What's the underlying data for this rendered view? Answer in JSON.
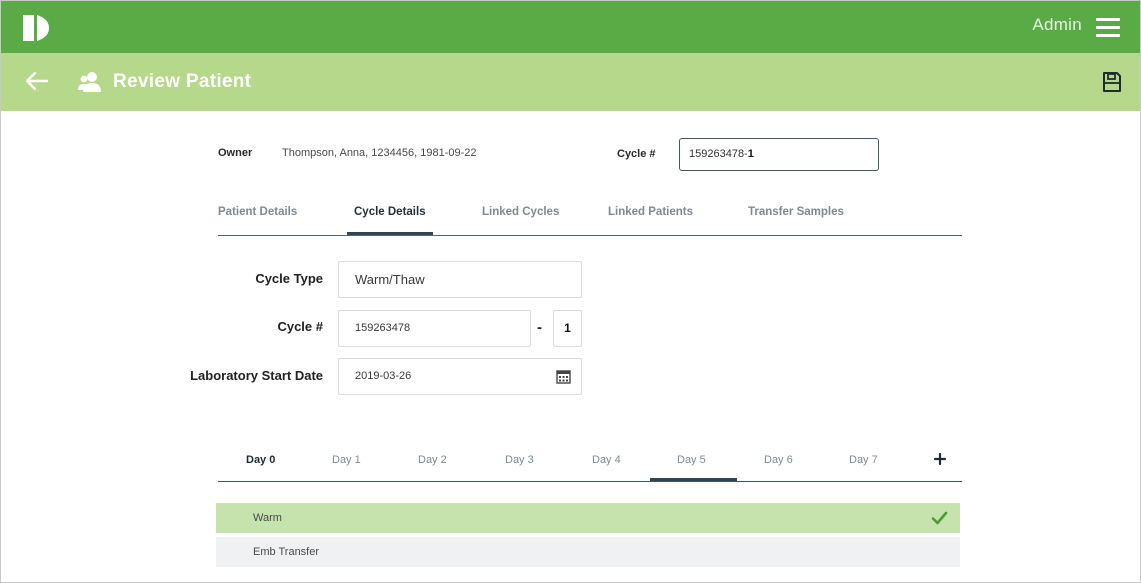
{
  "header": {
    "user_label": "Admin",
    "page_title": "Review Patient",
    "colors": {
      "brand_green": "#5aab46",
      "sub_green": "#b5d88a"
    }
  },
  "owner": {
    "label": "Owner",
    "value": "Thompson, Anna, 1234456, 1981-09-22"
  },
  "cycle_header": {
    "label": "Cycle #",
    "value_main": "159263478-",
    "value_suffix": "1"
  },
  "tabs": [
    {
      "label": "Patient Details",
      "active": false
    },
    {
      "label": "Cycle Details",
      "active": true
    },
    {
      "label": "Linked Cycles",
      "active": false
    },
    {
      "label": "Linked Patients",
      "active": false
    },
    {
      "label": "Transfer Samples",
      "active": false
    }
  ],
  "form": {
    "cycle_type": {
      "label": "Cycle Type",
      "value": "Warm/Thaw"
    },
    "cycle_number": {
      "label": "Cycle #",
      "value": "159263478",
      "suffix": "1",
      "separator": "-"
    },
    "lab_start_date": {
      "label": "Laboratory Start Date",
      "value": "2019-03-26"
    }
  },
  "day_tabs": [
    {
      "label": "Day 0",
      "bold": true,
      "selected": false
    },
    {
      "label": "Day 1",
      "bold": false,
      "selected": false
    },
    {
      "label": "Day 2",
      "bold": false,
      "selected": false
    },
    {
      "label": "Day 3",
      "bold": false,
      "selected": false
    },
    {
      "label": "Day 4",
      "bold": false,
      "selected": false
    },
    {
      "label": "Day 5",
      "bold": false,
      "selected": true
    },
    {
      "label": "Day 6",
      "bold": false,
      "selected": false
    },
    {
      "label": "Day 7",
      "bold": false,
      "selected": false
    }
  ],
  "procedures": [
    {
      "label": "Warm",
      "done": true
    },
    {
      "label": "Emb Transfer",
      "done": false
    }
  ],
  "icons": [
    "logo-icon",
    "menu-icon",
    "back-arrow-icon",
    "patient-icon",
    "save-icon",
    "calendar-icon",
    "plus-icon",
    "check-icon"
  ]
}
